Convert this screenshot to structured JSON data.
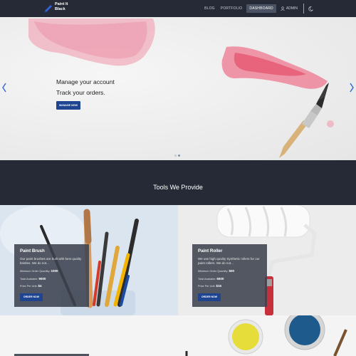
{
  "brand": {
    "name": "Paint It Black"
  },
  "nav": {
    "links": [
      "BLOG",
      "PORTFOLIO",
      "DASHBOARD"
    ],
    "admin": "ADMIN"
  },
  "hero": {
    "title": "Manage your account",
    "subtitle": "Track your orders.",
    "button": "MANAGE NOW",
    "slide_count": 2,
    "active_slide": 2
  },
  "tools": {
    "heading": "Tools We Provide"
  },
  "products": [
    {
      "name": "Paint Brush",
      "description": "Our paint brushes are built with best quality bristles. We do not...",
      "min_order_label": "Minimum Order Quantity:",
      "min_order": "1000",
      "available_label": "Total Available:",
      "available": "9000",
      "price_label": "Price Per Unit:",
      "price": "$4",
      "button": "ORDER NOW"
    },
    {
      "name": "Paint Roller",
      "description": "We use high quality Synthetic rollers for our paint rollers. We do not...",
      "min_order_label": "Minimum Order Quantity:",
      "min_order": "500",
      "available_label": "Total Available:",
      "available": "6500",
      "price_label": "Price Per Unit:",
      "price": "$15",
      "button": "ORDER NOW"
    }
  ],
  "colors": {
    "navbar": "#252a36",
    "accent": "#1f4591",
    "card_overlay": "#3c424e"
  },
  "icons": {
    "brand": "paint-brush-logo-icon",
    "user": "user-icon",
    "theme": "moon-icon",
    "prev": "chevron-left-icon",
    "next": "chevron-right-icon"
  }
}
